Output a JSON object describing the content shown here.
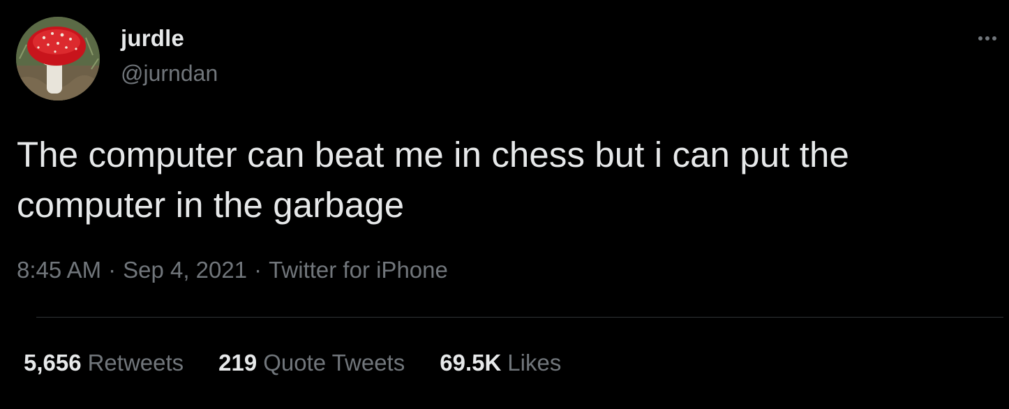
{
  "author": {
    "display_name": "jurdle",
    "handle": "@jurndan"
  },
  "tweet": {
    "text": "The computer can beat me in chess but i can put the computer in the garbage",
    "time": "8:45 AM",
    "separator": "·",
    "date": "Sep 4, 2021",
    "source": "Twitter for iPhone"
  },
  "stats": [
    {
      "count": "5,656",
      "label": "Retweets"
    },
    {
      "count": "219",
      "label": "Quote Tweets"
    },
    {
      "count": "69.5K",
      "label": "Likes"
    }
  ],
  "icons": {
    "more": "more-horizontal-icon",
    "avatar": "mushroom-avatar"
  },
  "colors": {
    "background": "#000000",
    "primary_text": "#e7e9ea",
    "secondary_text": "#71767b",
    "divider": "#2f3336"
  }
}
